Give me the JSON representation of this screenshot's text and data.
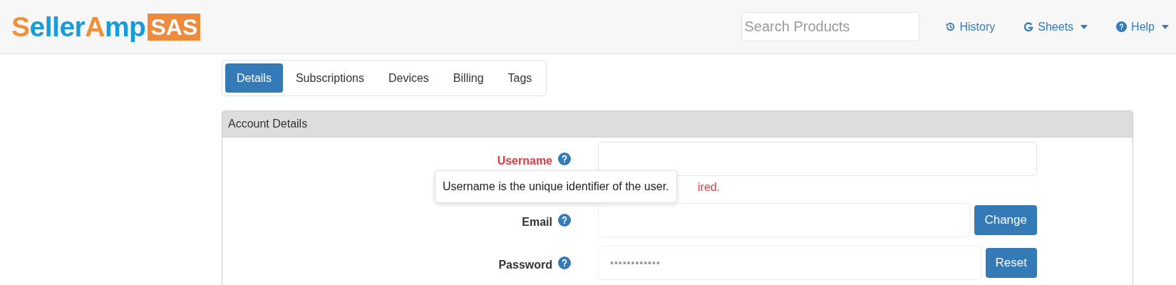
{
  "header": {
    "logo": {
      "parts": [
        {
          "text": "S",
          "color": "#f0913a"
        },
        {
          "text": "eller",
          "color": "#1a9ad8"
        },
        {
          "text": "A",
          "color": "#f0913a"
        },
        {
          "text": "mp",
          "color": "#1a9ad8"
        }
      ],
      "badge": "SAS"
    },
    "search": {
      "placeholder": "Search Products"
    },
    "nav": [
      {
        "kind": "history",
        "label": "History",
        "dropdown": false
      },
      {
        "kind": "google",
        "label": "Sheets",
        "dropdown": true
      },
      {
        "kind": "help",
        "label": "Help",
        "dropdown": true
      }
    ]
  },
  "tabs": [
    {
      "label": "Details",
      "selected": true
    },
    {
      "label": "Subscriptions",
      "selected": false
    },
    {
      "label": "Devices",
      "selected": false
    },
    {
      "label": "Billing",
      "selected": false
    },
    {
      "label": "Tags",
      "selected": false
    }
  ],
  "panel": {
    "title": "Account Details",
    "fields": [
      {
        "label": "Username",
        "invalid": true,
        "error": "ired.",
        "tooltip": "Username is the unique identifier of the user."
      },
      {
        "label": "Email",
        "invalid": false,
        "button": "Change"
      },
      {
        "label": "Password",
        "invalid": false,
        "value": "••••••••••••",
        "button": "Reset"
      }
    ]
  }
}
